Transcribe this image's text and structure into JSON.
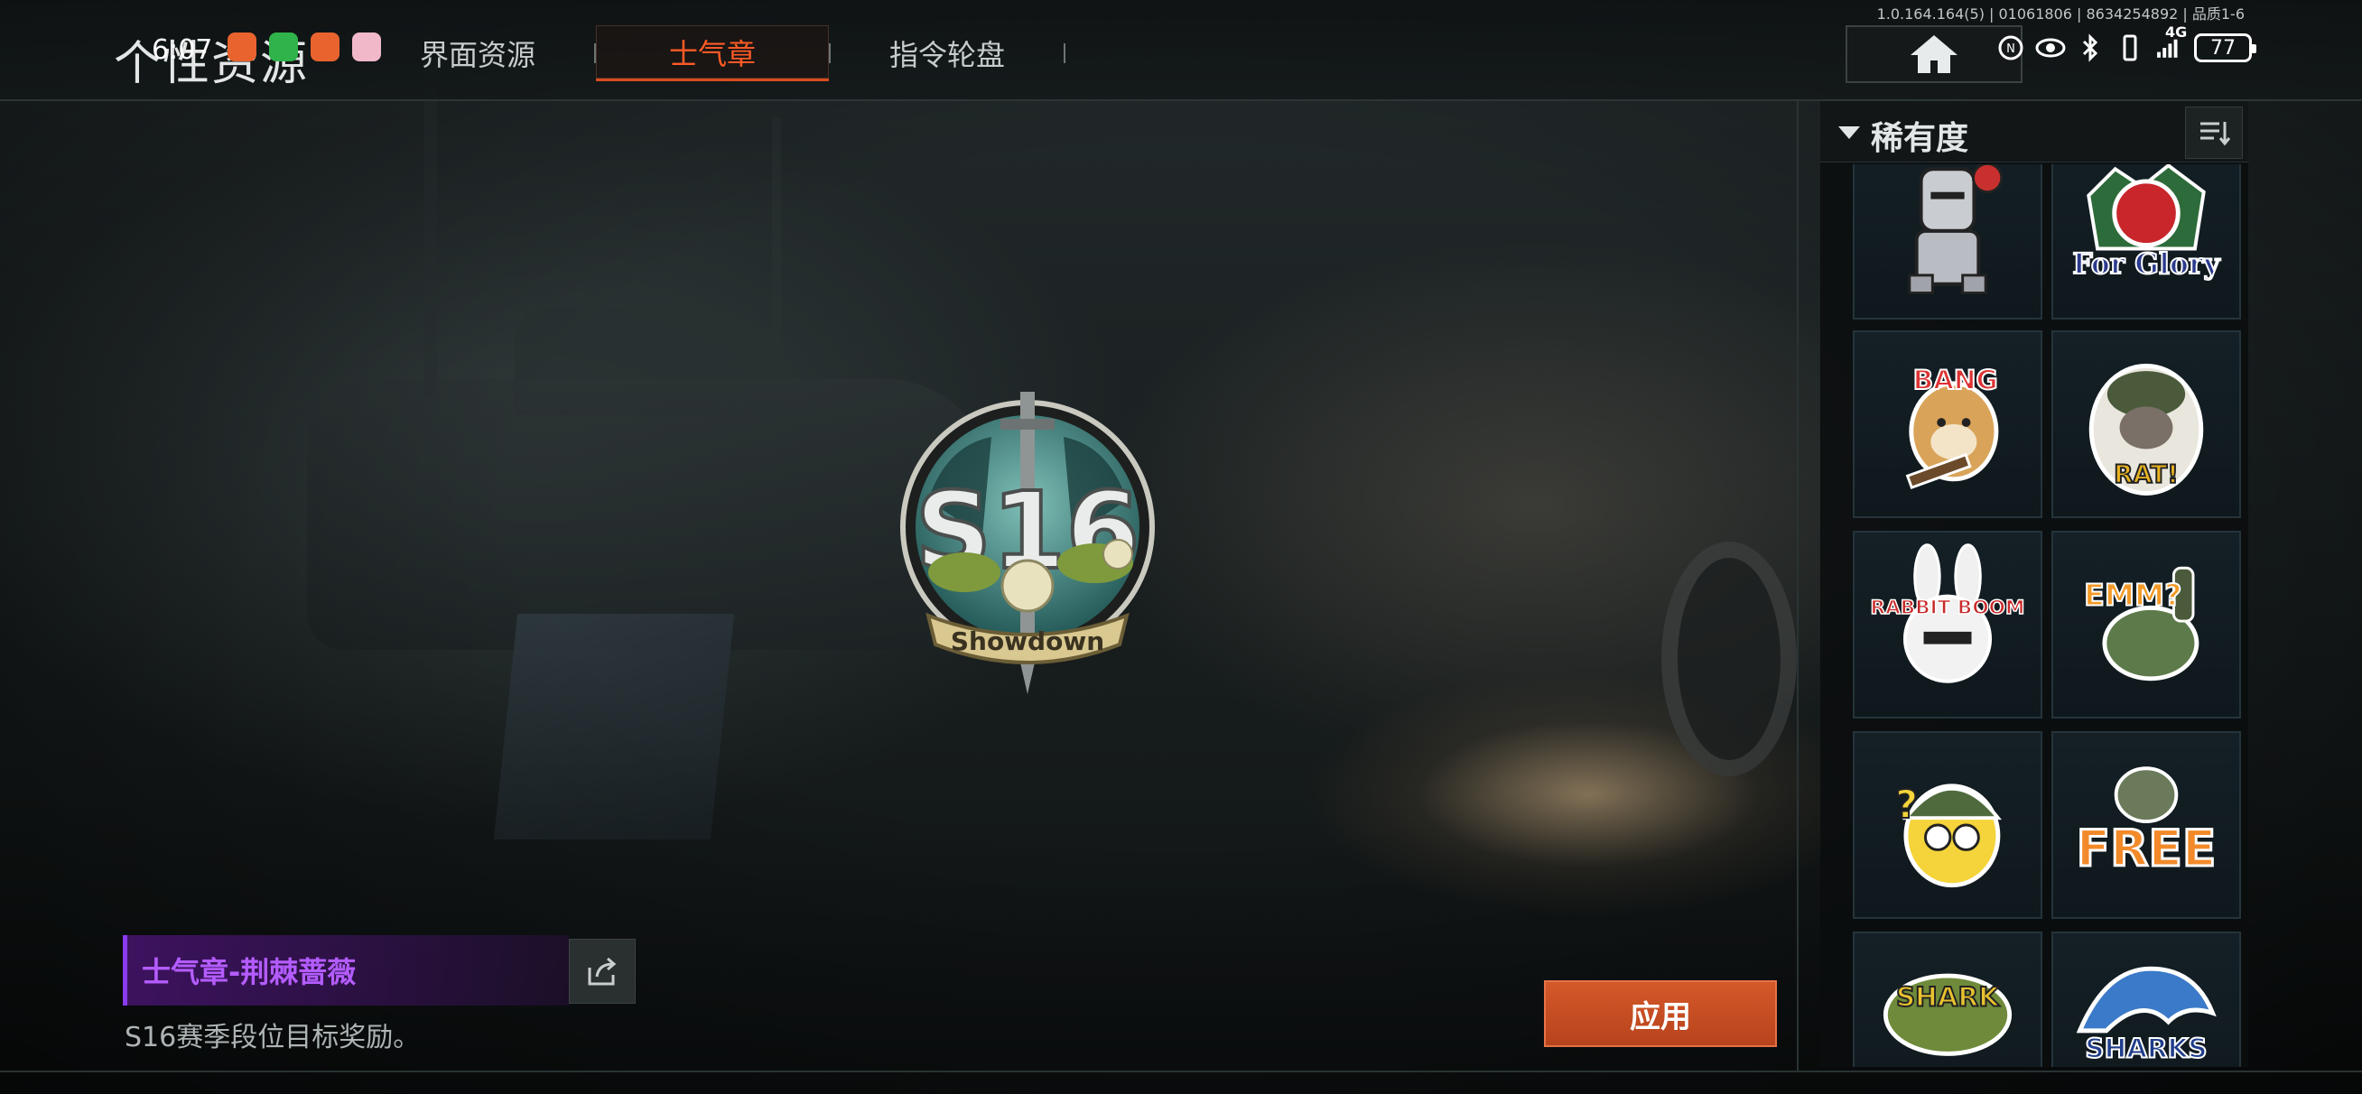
{
  "header": {
    "title": "个性资源",
    "system_time": "6:07",
    "tabs": [
      {
        "label": "界面资源",
        "active": false
      },
      {
        "label": "士气章",
        "active": true
      },
      {
        "label": "指令轮盘",
        "active": false
      }
    ],
    "build_info": "1.0.164.164(5) | 01061806 | 8634254892 | 品质1-6",
    "battery": "77",
    "network": "4G"
  },
  "badge": {
    "season_text": "S16",
    "banner_text": "Showdown"
  },
  "selected_item": {
    "name": "士气章-荆棘蔷薇",
    "description": "S16赛季段位目标奖励。",
    "name_color": "#b45cff"
  },
  "actions": {
    "apply_label": "应用"
  },
  "panel": {
    "filter_label": "稀有度",
    "items": [
      {
        "icon": "knight-rose-sticker",
        "text": ""
      },
      {
        "icon": "for-glory-rose-sticker",
        "text": "For Glory"
      },
      {
        "icon": "doge-bang-sticker",
        "text": "BANG"
      },
      {
        "icon": "rat-soldier-sticker",
        "text": "RAT!"
      },
      {
        "icon": "rabbit-boom-sticker",
        "text": "RABBIT BOOM"
      },
      {
        "icon": "emm-grenade-sticker",
        "text": "EMM?"
      },
      {
        "icon": "confused-helmet-sticker",
        "text": ""
      },
      {
        "icon": "free-sticker",
        "text": "FREE"
      },
      {
        "icon": "shark-croc-sticker",
        "text": "SHARK"
      },
      {
        "icon": "sharks-wave-sticker",
        "text": "SHARKS"
      }
    ]
  },
  "colors": {
    "accent": "#d84c1f",
    "active_tab_text": "#ff5a26",
    "apply_button": "#c44d22",
    "rarity_purple": "#8a3bf0"
  }
}
